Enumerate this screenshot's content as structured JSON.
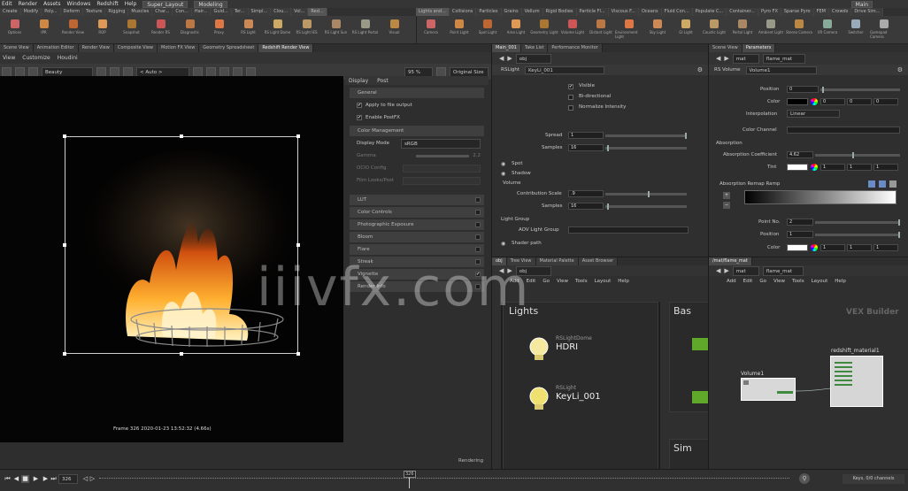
{
  "menu": {
    "items": [
      "Edit",
      "Render",
      "Assets",
      "Windows",
      "Redshift",
      "Help"
    ],
    "desktop": "Super_Layout",
    "context": "Modeling",
    "right": "Main"
  },
  "shelf_tabs_left": [
    "Create",
    "Modify",
    "Poly...",
    "Deform",
    "Texture",
    "Rigging",
    "Muscles",
    "Char...",
    "Con...",
    "Hair...",
    "Guid...",
    "Ter...",
    "Simpl...",
    "Clou...",
    "Vol...",
    "Red..."
  ],
  "shelf_tabs_right": [
    "Lights and...",
    "Collisions",
    "Particles",
    "Grains",
    "Vellum",
    "Rigid Bodies",
    "Particle Fl...",
    "Viscous F...",
    "Oceans",
    "Fluid Con...",
    "Populate C...",
    "Container...",
    "Pyro FX",
    "Sparse Pyro",
    "FEM",
    "Crowds",
    "Drive Sim..."
  ],
  "shelf_tools_left": [
    "Options",
    "IPR",
    "Render View",
    "ROP",
    "Snapshot",
    "Render RS",
    "Diagnostic",
    "Proxy",
    "RS Light",
    "RS Light Dome",
    "RS Light IES",
    "RS Light Sun",
    "RS Light Portal",
    "Visual"
  ],
  "shelf_tools_right": [
    "Camera",
    "Point Light",
    "Spot Light",
    "Area Light",
    "Geometry Light",
    "Volume Light",
    "Distant Light",
    "Environment Light",
    "Sky Light",
    "GI Light",
    "Caustic Light",
    "Portal Light",
    "Ambient Light",
    "Stereo Camera",
    "VR Camera",
    "Switcher",
    "Gamepad Camera"
  ],
  "viewer": {
    "tabs": [
      "Scene View",
      "Animation Editor",
      "Render View",
      "Composite View",
      "Motion FX View",
      "Geometry Spreadsheet",
      "Redshift Render View"
    ],
    "menu": [
      "View",
      "Customize",
      "Houdini"
    ],
    "aov": "Beauty",
    "auto": "< Auto >",
    "zoom": "95 %",
    "size_mode": "Original Size",
    "frame_info": "Frame  326   2020-01-23  13:52:32  (4.66s)",
    "status": "Rendering"
  },
  "settings": {
    "tabs": [
      "Display",
      "Post"
    ],
    "sections": [
      {
        "label": "General",
        "type": "section"
      },
      {
        "label": "Apply to file output",
        "type": "check",
        "checked": true
      },
      {
        "label": "Enable PostFX",
        "type": "check",
        "checked": true
      },
      {
        "label": "Color Management",
        "type": "section"
      },
      {
        "label": "Display Mode",
        "type": "dropdown",
        "value": "sRGB"
      },
      {
        "label": "Gamma",
        "type": "slider",
        "value": "2.2"
      },
      {
        "label": "OCIO Config",
        "type": "field"
      },
      {
        "label": "Film Looks/Post",
        "type": "field"
      }
    ],
    "toggles": [
      "LUT",
      "Color Controls",
      "Photographic Exposure",
      "Bloom",
      "Flare",
      "Streak",
      "Vignette",
      "Render Info"
    ]
  },
  "param_left": {
    "tabs": [
      "Main_001",
      "Take List",
      "Performance Monitor"
    ],
    "path": "obj",
    "node_type": "RSLight",
    "node_name": "KeyLi_001",
    "rows": [
      {
        "label": "Visible",
        "checked": true
      },
      {
        "label": "Bi-directional",
        "checked": false
      },
      {
        "label": "Normalize Intensity",
        "checked": false
      }
    ],
    "spread_label": "Spread",
    "spread_value": "1",
    "samples_label": "Samples",
    "samples_value": "16",
    "spot": "Spot",
    "shadow": "Shadow",
    "volume": "Volume",
    "contrib_label": "Contribution Scale",
    "contrib_value": ".9",
    "vsamples_label": "Samples",
    "vsamples_value": "16",
    "light_group": "Light Group",
    "aov_group": "AOV Light Group",
    "shader_path": "Shader path"
  },
  "param_right": {
    "tabs": [
      "Scene View",
      "Parameters"
    ],
    "path": "mat",
    "path2": "flame_mat",
    "node_type": "RS Volume",
    "node_name": "Volume1",
    "position_label": "Position",
    "position_value": "0",
    "color_label": "Color",
    "color_values": [
      "0",
      "0",
      "0"
    ],
    "interp_label": "Interpolation",
    "interp_value": "Linear",
    "color_channel": "Color Channel",
    "absorption": "Absorption",
    "abs_coeff_label": "Absorption Coefficient",
    "abs_coeff_value": "4.62",
    "tint_label": "Tint",
    "tint_values": [
      "1",
      "1",
      "1"
    ],
    "ramp_label": "Absorption Remap Ramp",
    "point_no_label": "Point No.",
    "point_no_value": "2",
    "pos2_label": "Position",
    "pos2_value": "1",
    "color2_label": "Color",
    "color2_values": [
      "1",
      "1",
      "1"
    ]
  },
  "net_left": {
    "tabs": [
      "obj",
      "Tree View",
      "Material Palette",
      "Asset Browser"
    ],
    "path": "obj",
    "menu": [
      "Add",
      "Edit",
      "Go",
      "View",
      "Tools",
      "Layout",
      "Help"
    ],
    "box1": "Lights",
    "box2": "Bas",
    "box3": "Sim",
    "nodes": [
      {
        "type": "RSLightDome",
        "name": "HDRI"
      },
      {
        "type": "RSLight",
        "name": "KeyLi_001"
      }
    ]
  },
  "net_right": {
    "tabs": [
      "/mat/flame_mat"
    ],
    "path": "mat",
    "path2": "flame_mat",
    "menu": [
      "Add",
      "Edit",
      "Go",
      "View",
      "Tools",
      "Layout",
      "Help"
    ],
    "title": "VEX Builder",
    "node1": "Volume1",
    "node2": "redshift_material1"
  },
  "timeline": {
    "frame": "326",
    "marker": "326",
    "keys_label": "Keys, 0/0 channels"
  },
  "watermark": "iiivfx.com"
}
